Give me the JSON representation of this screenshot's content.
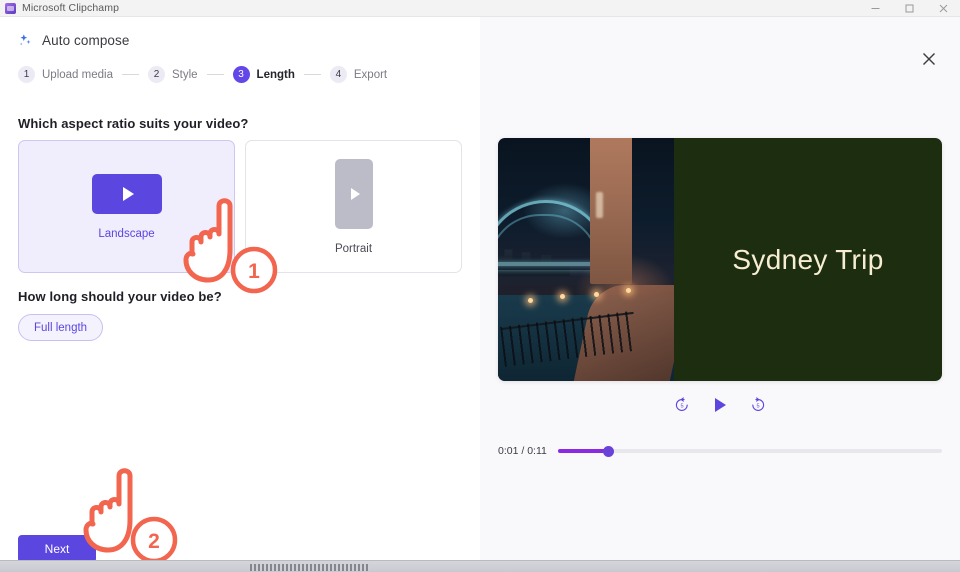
{
  "window": {
    "title": "Microsoft Clipchamp",
    "app_icon": "clipchamp-icon",
    "controls": {
      "minimize": "minimize-icon",
      "maximize": "maximize-icon",
      "close": "close-icon"
    }
  },
  "left_pane": {
    "autocompose": {
      "icon": "sparkles-icon",
      "label": "Auto compose"
    },
    "stepper": [
      {
        "number": "1",
        "label": "Upload media",
        "active": false
      },
      {
        "number": "2",
        "label": "Style",
        "active": false
      },
      {
        "number": "3",
        "label": "Length",
        "active": true
      },
      {
        "number": "4",
        "label": "Export",
        "active": false
      }
    ],
    "aspect_section": {
      "heading": "Which aspect ratio suits your video?",
      "options": [
        {
          "label": "Landscape",
          "selected": true
        },
        {
          "label": "Portrait",
          "selected": false
        }
      ]
    },
    "length_section": {
      "heading": "How long should your video be?",
      "chips": [
        {
          "label": "Full length",
          "selected": true
        }
      ]
    },
    "next_button": "Next"
  },
  "right_pane": {
    "close_icon": "close-icon",
    "preview": {
      "title_text": "Sydney Trip",
      "title_panel_color": "#1d2d0f",
      "title_text_color": "#f6edd2",
      "photo_alt": "sydney-harbour-bridge-night-photo"
    },
    "playback": {
      "skip_back": "skip-back-5s-icon",
      "skip_back_seconds": "5",
      "play": "play-icon",
      "skip_forward": "skip-forward-5s-icon",
      "skip_forward_seconds": "5"
    },
    "timeline": {
      "time_display": "0:01 / 0:11",
      "current_time": "0:01",
      "duration": "0:11",
      "progress_percent": 13
    }
  },
  "annotations": [
    {
      "number": "1",
      "target": "landscape-aspect-card"
    },
    {
      "number": "2",
      "target": "next-button"
    }
  ],
  "colors": {
    "accent_purple": "#5b46e0",
    "annotation_orange": "#f2654e",
    "selected_card_bg": "#f0edfc"
  }
}
